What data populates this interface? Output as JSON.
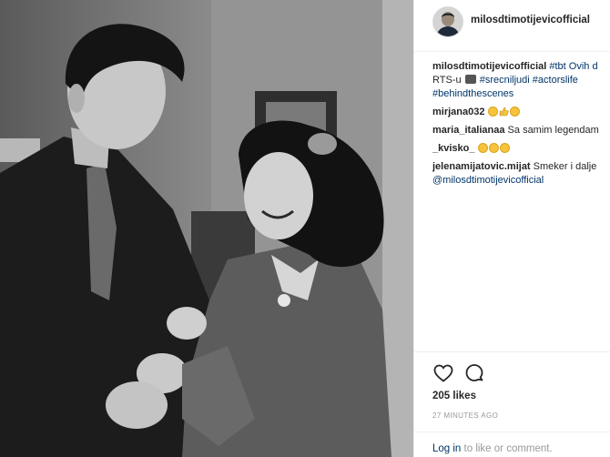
{
  "post": {
    "username": "milosdtimotijevicofficial",
    "caption": {
      "user": "milosdtimotijevicofficial",
      "line1_rest": " #tbt Ovih d",
      "line2_a": "RTS-u ",
      "line2_b": "#srecniljudi #actorslife",
      "line3": "#behindthescenes"
    },
    "comments": [
      {
        "user": "mirjana032",
        "text": ""
      },
      {
        "user": "maria_italianaa",
        "text": " Sa samim legendam"
      },
      {
        "user": "_kvisko_",
        "text": ""
      },
      {
        "user": "jelenamijatovic.mijat",
        "text": " Smeker i dalje",
        "line2": "@milosdtimotijevicofficial"
      }
    ],
    "likes": "205 likes",
    "time": "27 MINUTES AGO",
    "login_link": "Log in",
    "login_rest": " to like or comment."
  },
  "icons": {
    "like": "heart-icon",
    "comment": "comment-icon"
  },
  "colors": {
    "link": "#003569",
    "muted": "#999999",
    "text": "#262626"
  }
}
